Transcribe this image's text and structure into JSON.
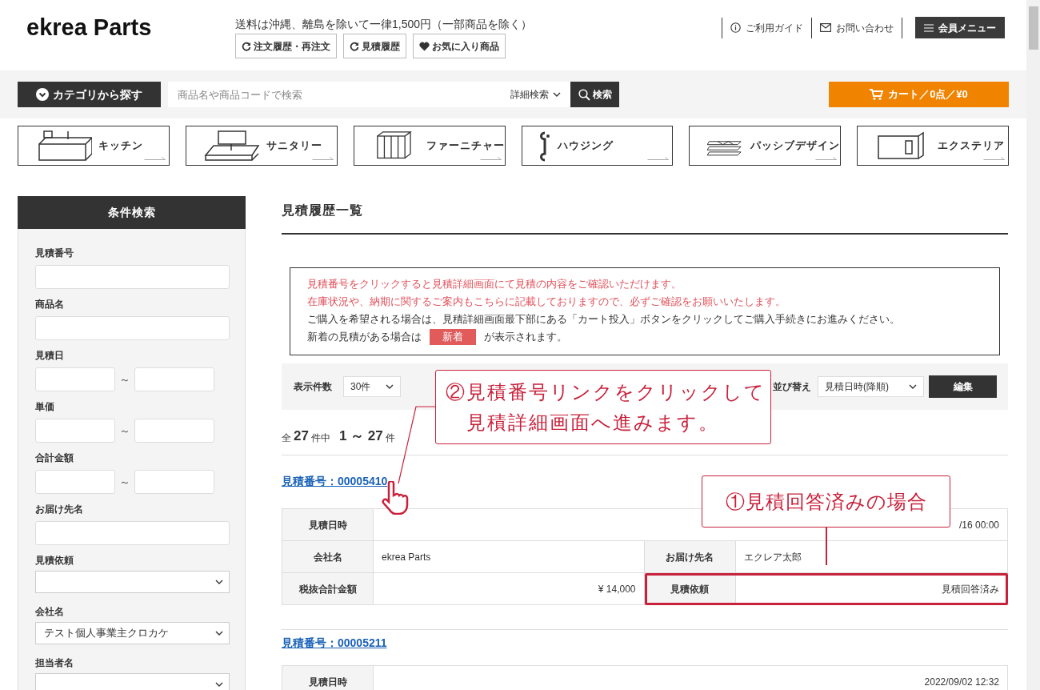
{
  "header": {
    "logo": "ekrea Parts",
    "shipping_notice": "送料は沖縄、離島を除いて一律1,500円（一部商品を除く）",
    "quick_links": [
      {
        "label": "注文履歴・再注文",
        "kind": "refresh"
      },
      {
        "label": "見積履歴",
        "kind": "refresh"
      },
      {
        "label": "お気に入り商品",
        "kind": "heart"
      }
    ],
    "utility_links": [
      {
        "label": "ご利用ガイド",
        "kind": "info"
      },
      {
        "label": "お問い合わせ",
        "kind": "mail"
      }
    ],
    "member_menu": "会員メニュー"
  },
  "search_bar": {
    "category_button": "カテゴリから探す",
    "placeholder": "商品名や商品コードで検索",
    "advanced_search": "詳細検索",
    "search_button": "検索",
    "cart": "カート／0点／¥0"
  },
  "categories": [
    {
      "label": "キッチン",
      "kind": "kitchen"
    },
    {
      "label": "サニタリー",
      "kind": "sanitary"
    },
    {
      "label": "ファーニチャー",
      "kind": "furniture"
    },
    {
      "label": "ハウジング",
      "kind": "housing"
    },
    {
      "label": "パッシブデザイン",
      "kind": "passive"
    },
    {
      "label": "エクステリア",
      "kind": "exterior"
    }
  ],
  "sidebar": {
    "title": "条件検索",
    "fields": [
      {
        "label": "見積番号",
        "kind": "text"
      },
      {
        "label": "商品名",
        "kind": "text"
      },
      {
        "label": "見積日",
        "kind": "range",
        "separator": "～"
      },
      {
        "label": "単価",
        "kind": "range",
        "separator": "～"
      },
      {
        "label": "合計金額",
        "kind": "range",
        "separator": "～"
      },
      {
        "label": "お届け先名",
        "kind": "text"
      },
      {
        "label": "見積依頼",
        "kind": "select"
      },
      {
        "label": "会社名",
        "kind": "select",
        "value": "テスト個人事業主クロカケ"
      },
      {
        "label": "担当者名",
        "kind": "select"
      }
    ]
  },
  "main": {
    "title": "見積履歴一覧",
    "notice": [
      {
        "kind": "alert",
        "text": "見積番号をクリックすると見積詳細画面にて見積の内容をご確認いただけます。"
      },
      {
        "kind": "alert",
        "text": "在庫状況や、納期に関するご案内もこちらに記載しておりますので、必ずご確認をお願いいたします。"
      },
      {
        "kind": "plain",
        "text": "ご購入を希望される場合は、見積詳細画面最下部にある「カート投入」ボタンをクリックしてご購入手続きにお進みください。"
      },
      {
        "kind": "badge",
        "before": "新着の見積がある場合は",
        "badge": "新着",
        "after": "が表示されます。"
      }
    ],
    "toolbar": {
      "per_page_label": "表示件数",
      "per_page": "30件",
      "sort_label": "並び替え",
      "sort": "見積日時(降順)",
      "edit_button": "編集"
    },
    "count": {
      "prefix": "全",
      "total": "27",
      "middle": "件中",
      "range": "1 ～ 27",
      "suffix": "件"
    },
    "quotes": [
      {
        "link": "見積番号：00005410",
        "rows": [
          [
            {
              "label": "見積日時",
              "value": "/16 00:00",
              "kind": "date",
              "highlighted": false
            }
          ],
          [
            {
              "label": "会社名",
              "value": "ekrea Parts",
              "kind": "text",
              "highlighted": false
            },
            {
              "label": "お届け先名",
              "value": "エクレア太郎",
              "kind": "text",
              "highlighted": false
            }
          ],
          [
            {
              "label": "税抜合計金額",
              "value": "¥ 14,000",
              "kind": "amount",
              "highlighted": false
            },
            {
              "label": "見積依頼",
              "value": "見積回答済み",
              "kind": "status",
              "highlighted": true
            }
          ]
        ]
      },
      {
        "link": "見積番号：00005211",
        "rows": [
          [
            {
              "label": "見積日時",
              "value": "2022/09/02 12:32",
              "kind": "date",
              "highlighted": false
            }
          ]
        ]
      }
    ],
    "annotations": [
      {
        "kind": "link_hint",
        "lines": [
          "②見積番号リンクをクリックして",
          "見積詳細画面へ進みます。"
        ]
      },
      {
        "kind": "status_hint",
        "lines": [
          "①見積回答済みの場合"
        ]
      }
    ]
  }
}
